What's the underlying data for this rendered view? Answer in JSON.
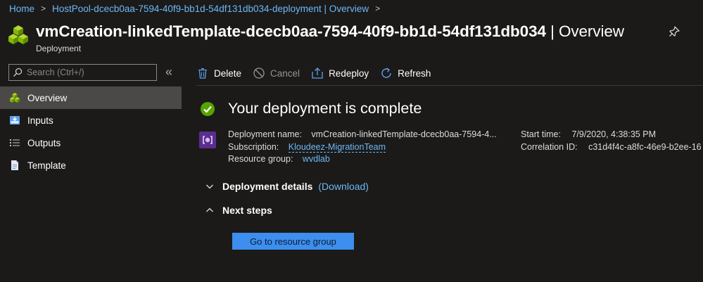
{
  "breadcrumb": {
    "items": [
      "Home",
      "HostPool-dcecb0aa-7594-40f9-bb1d-54df131db034-deployment | Overview"
    ],
    "separator": ">"
  },
  "header": {
    "title": "vmCreation-linkedTemplate-dcecb0aa-7594-40f9-bb1d-54df131db034",
    "title_suffix": "| Overview",
    "subtitle": "Deployment",
    "icon": "deployment-cubes-icon",
    "pin_icon": "pin-icon"
  },
  "sidebar": {
    "search_placeholder": "Search (Ctrl+/)",
    "collapse_glyph": "«",
    "items": [
      {
        "label": "Overview",
        "icon": "overview-icon",
        "active": true
      },
      {
        "label": "Inputs",
        "icon": "inputs-icon",
        "active": false
      },
      {
        "label": "Outputs",
        "icon": "outputs-icon",
        "active": false
      },
      {
        "label": "Template",
        "icon": "template-icon",
        "active": false
      }
    ]
  },
  "toolbar": {
    "delete_label": "Delete",
    "cancel_label": "Cancel",
    "redeploy_label": "Redeploy",
    "refresh_label": "Refresh"
  },
  "main": {
    "status_title": "Your deployment is complete",
    "deployment_name_label": "Deployment name:",
    "deployment_name_value": "vmCreation-linkedTemplate-dcecb0aa-7594-4...",
    "subscription_label": "Subscription:",
    "subscription_value": "Kloudeez-MigrationTeam",
    "resource_group_label": "Resource group:",
    "resource_group_value": "wvdlab",
    "start_time_label": "Start time:",
    "start_time_value": "7/9/2020, 4:38:35 PM",
    "correlation_id_label": "Correlation ID:",
    "correlation_id_value": "c31d4f4c-a8fc-46e9-b2ee-16",
    "deployment_details_label": "Deployment details",
    "download_label": "(Download)",
    "next_steps_label": "Next steps",
    "go_button_label": "Go to resource group"
  },
  "colors": {
    "background": "#1b1a19",
    "link": "#6cb8f6",
    "primary_button": "#3d8eee",
    "success": "#57a300",
    "active_nav": "#4a4948"
  }
}
